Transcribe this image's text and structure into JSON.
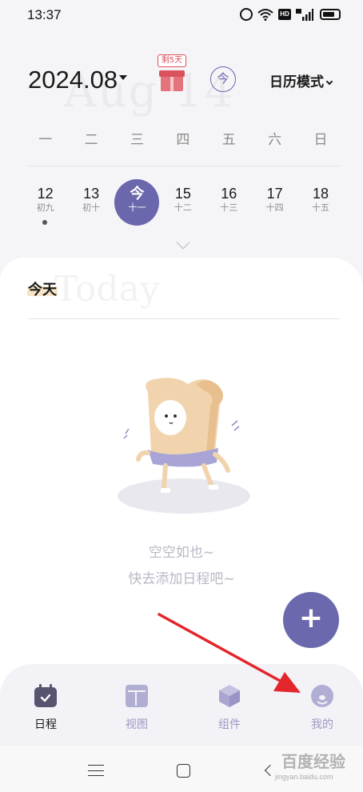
{
  "status_bar": {
    "time": "13:37",
    "icons": [
      "alarm-icon",
      "wifi-icon",
      "hd-icon",
      "signal-4g-icon",
      "battery-icon"
    ],
    "hd_text": "HD"
  },
  "header": {
    "month": "2024.08",
    "watermark": "Aug 14",
    "gift_tag": "剩5天",
    "today_button": "今",
    "mode_label": "日历模式"
  },
  "weekdays": [
    "一",
    "二",
    "三",
    "四",
    "五",
    "六",
    "日"
  ],
  "dates": [
    {
      "day": "12",
      "lunar": "初九"
    },
    {
      "day": "13",
      "lunar": "初十"
    },
    {
      "day": "今",
      "lunar": "十一"
    },
    {
      "day": "15",
      "lunar": "十二"
    },
    {
      "day": "16",
      "lunar": "十三"
    },
    {
      "day": "17",
      "lunar": "十四"
    },
    {
      "day": "18",
      "lunar": "十五"
    }
  ],
  "content": {
    "section_title": "今天",
    "watermark": "Today",
    "empty_line1": "空空如也~",
    "empty_line2": "快去添加日程吧~",
    "fab_label": "+"
  },
  "bottom_nav": [
    {
      "label": "日程",
      "icon": "calendar-icon"
    },
    {
      "label": "视图",
      "icon": "layout-icon"
    },
    {
      "label": "组件",
      "icon": "cube-icon"
    },
    {
      "label": "我的",
      "icon": "profile-icon"
    }
  ],
  "system_nav": {
    "icons": [
      "menu-icon",
      "home-icon",
      "back-icon"
    ]
  },
  "overlay": {
    "watermark_text": "百度经验",
    "watermark_sub": "jingyan.baidu.com"
  },
  "colors": {
    "accent": "#6b67ad",
    "nav_inactive": "#b1aed3",
    "gift": "#d9535e",
    "arrow": "#e3262b"
  }
}
